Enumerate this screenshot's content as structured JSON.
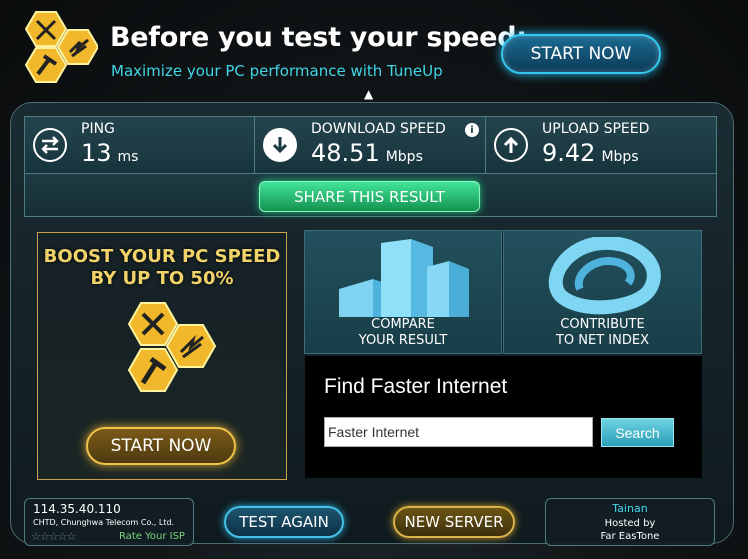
{
  "header": {
    "title": "Before you test your speed:",
    "subtitle": "Maximize your PC performance with TuneUp",
    "start_now": "START NOW",
    "arrow_icon": "triangle-up-icon"
  },
  "stats": {
    "ping": {
      "label": "PING",
      "value": "13",
      "unit": "ms",
      "icon": "exchange-arrows-icon"
    },
    "download": {
      "label": "DOWNLOAD SPEED",
      "value": "48.51",
      "unit": "Mbps",
      "icon": "arrow-down-icon",
      "info_icon": "info-icon"
    },
    "upload": {
      "label": "UPLOAD SPEED",
      "value": "9.42",
      "unit": "Mbps",
      "icon": "arrow-up-icon"
    }
  },
  "share": {
    "label": "SHARE THIS RESULT"
  },
  "boost": {
    "line1": "BOOST YOUR PC SPEED",
    "line2": "BY UP TO 50%",
    "start_now": "START NOW"
  },
  "tiles": {
    "compare": {
      "line1": "COMPARE",
      "line2": "YOUR RESULT"
    },
    "contribute": {
      "line1": "CONTRIBUTE",
      "line2": "TO NET INDEX"
    }
  },
  "find": {
    "title": "Find Faster Internet",
    "input_value": "Faster Internet",
    "button": "Search"
  },
  "isp": {
    "ip": "114.35.40.110",
    "name": "CHTD, Chunghwa Telecom Co., Ltd.",
    "stars": "☆☆☆☆☆",
    "rate": "Rate Your ISP"
  },
  "buttons": {
    "test_again": "TEST AGAIN",
    "new_server": "NEW SERVER"
  },
  "server": {
    "city": "Tainan",
    "hosted_by": "Hosted by",
    "provider": "Far EasTone"
  },
  "colors": {
    "accent_cyan": "#3fd6e6",
    "share_green": "#1ec77a",
    "boost_gold": "#f1d36a"
  }
}
